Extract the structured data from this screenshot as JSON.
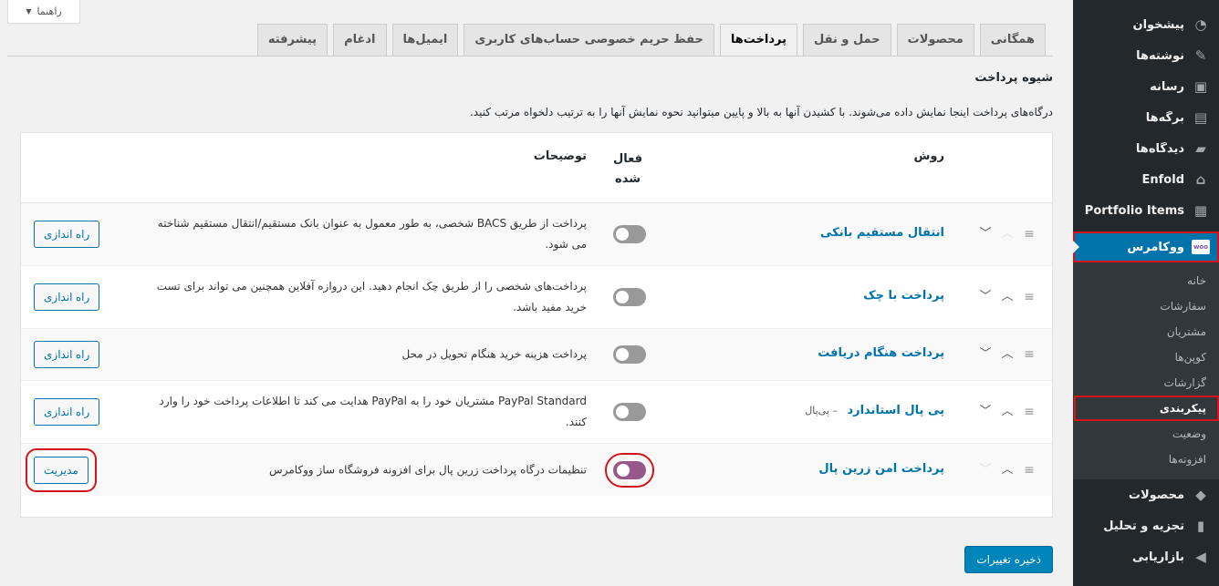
{
  "help_tab": {
    "label": "راهنما"
  },
  "sidebar": {
    "items_top": [
      {
        "label": "پیشخوان",
        "icon": "dashboard-icon",
        "glyph": "◔"
      },
      {
        "label": "نوشته‌ها",
        "icon": "pin-icon",
        "glyph": "✎"
      },
      {
        "label": "رسانه",
        "icon": "media-icon",
        "glyph": "▣"
      },
      {
        "label": "برگه‌ها",
        "icon": "pages-icon",
        "glyph": "▤"
      },
      {
        "label": "دیدگاه‌ها",
        "icon": "comments-icon",
        "glyph": "▰"
      },
      {
        "label": "Enfold",
        "icon": "home-icon",
        "glyph": "⌂"
      },
      {
        "label": "Portfolio Items",
        "icon": "portfolio-icon",
        "glyph": "▦"
      }
    ],
    "woocommerce": {
      "label": "ووکامرس",
      "badge": "woo"
    },
    "submenu": [
      {
        "label": "خانه"
      },
      {
        "label": "سفارشات"
      },
      {
        "label": "مشتریان"
      },
      {
        "label": "کوپن‌ها"
      },
      {
        "label": "گزارشات"
      },
      {
        "label": "پیکربندی"
      },
      {
        "label": "وضعیت"
      },
      {
        "label": "افزونه‌ها"
      }
    ],
    "items_bottom": [
      {
        "label": "محصولات",
        "icon": "products-icon",
        "glyph": "◆"
      },
      {
        "label": "تجزیه و تحلیل",
        "icon": "analytics-icon",
        "glyph": "▮"
      },
      {
        "label": "بازاریابی",
        "icon": "megaphone-icon",
        "glyph": "◀"
      }
    ]
  },
  "tabs": [
    {
      "label": "همگانی"
    },
    {
      "label": "محصولات"
    },
    {
      "label": "حمل و نقل"
    },
    {
      "label": "پرداخت‌ها"
    },
    {
      "label": "حفظ حریم خصوصی حساب‌های کاربری"
    },
    {
      "label": "ایمیل‌ها"
    },
    {
      "label": "ادغام"
    },
    {
      "label": "پیشرفته"
    }
  ],
  "section": {
    "title": "شیوه پرداخت",
    "description": "درگاه‌های پرداخت اینجا نمایش داده می‌شوند. با کشیدن آنها به بالا و پایین میتوانید نحوه نمایش آنها را به ترتیب دلخواه مرتب کنید."
  },
  "table": {
    "headers": {
      "method": "روش",
      "enabled": "فعال شده",
      "description": "توضیحات"
    },
    "rows": [
      {
        "name": "انتقال مستقیم بانکی",
        "sub": "",
        "description": "پرداخت از طریق BACS شخصی، به طور معمول به عنوان بانک مستقیم/انتقال مستقیم شناخته می شود.",
        "button": "راه اندازی"
      },
      {
        "name": "پرداخت با چک",
        "sub": "",
        "description": "پرداخت‌های شخصی را از طریق چک انجام دهید. این دروازه آفلاین همچنین می تواند برای تست خرید مفید باشد.",
        "button": "راه اندازی"
      },
      {
        "name": "پرداخت هنگام دریافت",
        "sub": "",
        "description": "پرداخت هزینه خرید هنگام تحویل در محل",
        "button": "راه اندازی"
      },
      {
        "name": "پی پال استاندارد",
        "sub": "پی‌پال",
        "description": "PayPal Standard مشتریان خود را به PayPal هدایت می کند تا اطلاعات پرداخت خود را وارد کنند.",
        "button": "راه اندازی"
      },
      {
        "name": "پرداخت امن زرین پال",
        "sub": "",
        "description": "تنظیمات درگاه پرداخت زرین پال برای افزونه فروشگاه ساز ووکامرس",
        "button": "مدیریت"
      }
    ]
  },
  "save_button": {
    "label": "ذخیره تغییرات"
  },
  "colors": {
    "accent": "#0073aa",
    "woo_purple": "#96588a",
    "highlight_red": "#d4141b",
    "sidebar_bg": "#23282d"
  }
}
